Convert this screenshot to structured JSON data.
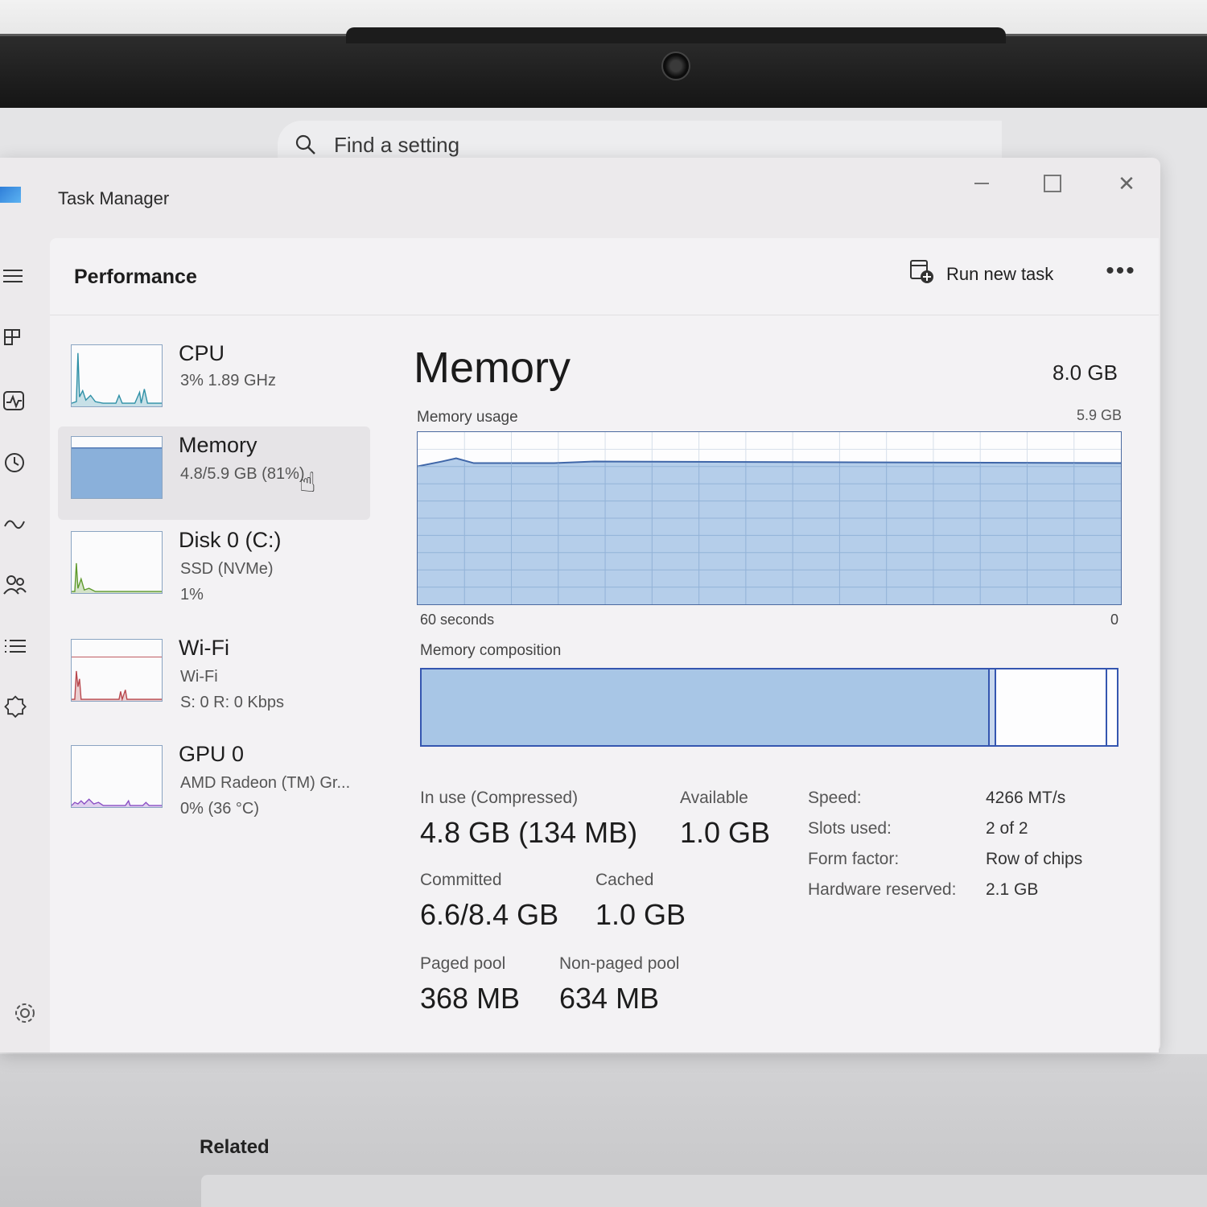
{
  "settings": {
    "search_placeholder": "Find a setting",
    "related_label": "Related"
  },
  "window": {
    "title": "Task Manager",
    "close_glyph": "✕"
  },
  "header": {
    "title": "Performance",
    "run_new_task": "Run new task",
    "more_glyph": "•••"
  },
  "devices": [
    {
      "name": "CPU",
      "line1": "3%  1.89 GHz",
      "line2": "",
      "graph_color": "#2d8fa6"
    },
    {
      "name": "Memory",
      "line1": "4.8/5.9 GB (81%)",
      "line2": "",
      "graph_color": "#8ab0da"
    },
    {
      "name": "Disk 0 (C:)",
      "line1": "SSD (NVMe)",
      "line2": "1%",
      "graph_color": "#5e9a2c"
    },
    {
      "name": "Wi-Fi",
      "line1": "Wi-Fi",
      "line2": "S: 0  R: 0 Kbps",
      "graph_color": "#b8464c"
    },
    {
      "name": "GPU 0",
      "line1": "AMD Radeon (TM) Gr...",
      "line2": "0%  (36 °C)",
      "graph_color": "#8a4fc4"
    }
  ],
  "memory": {
    "title": "Memory",
    "total": "8.0 GB",
    "usage_label": "Memory usage",
    "usage_max": "5.9 GB",
    "axis_left": "60 seconds",
    "axis_right": "0",
    "composition_label": "Memory composition",
    "usage_fraction": 0.82,
    "composition": {
      "in_use_fraction": 0.813,
      "accent": "#3556b0",
      "fill": "#a8c6e6"
    },
    "stats": {
      "in_use_label": "In use (Compressed)",
      "in_use_value": "4.8 GB (134 MB)",
      "available_label": "Available",
      "available_value": "1.0 GB",
      "committed_label": "Committed",
      "committed_value": "6.6/8.4 GB",
      "cached_label": "Cached",
      "cached_value": "1.0 GB",
      "paged_label": "Paged pool",
      "paged_value": "368 MB",
      "nonpaged_label": "Non-paged pool",
      "nonpaged_value": "634 MB"
    },
    "properties": [
      {
        "key": "Speed:",
        "value": "4266 MT/s"
      },
      {
        "key": "Slots used:",
        "value": "2 of 2"
      },
      {
        "key": "Form factor:",
        "value": "Row of chips"
      },
      {
        "key": "Hardware reserved:",
        "value": "2.1 GB"
      }
    ]
  }
}
